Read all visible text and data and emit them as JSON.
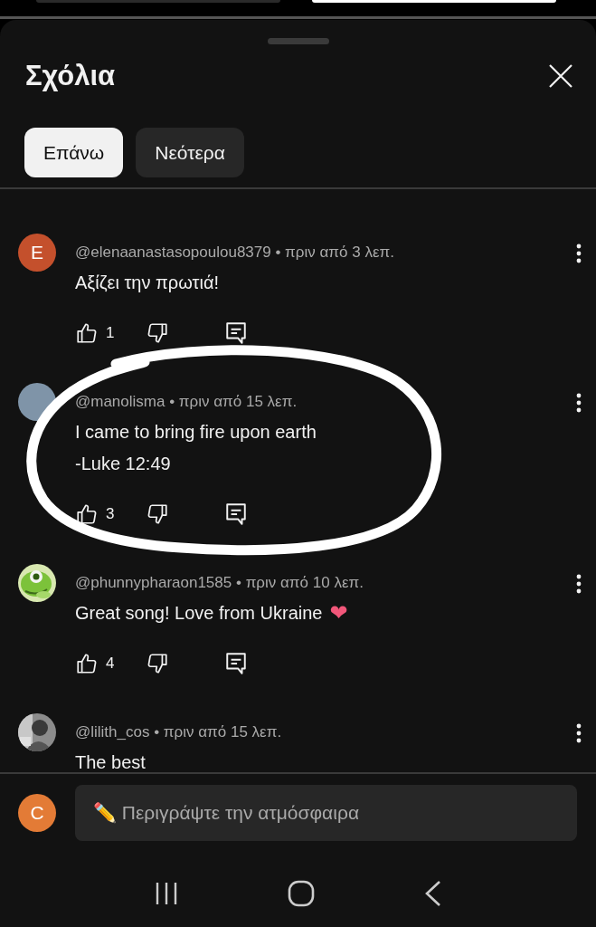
{
  "sheet": {
    "title": "Σχόλια"
  },
  "tabs": [
    {
      "label": "Επάνω",
      "selected": true
    },
    {
      "label": "Νεότερα",
      "selected": false
    }
  ],
  "comments": [
    {
      "author": "@elenaanastasopoulou8379",
      "dot": "•",
      "time": "πριν από 3 λεπ.",
      "lines": [
        "Αξίζει την πρωτιά!"
      ],
      "avatar": {
        "kind": "letter",
        "letter": "E",
        "color": "#c4502c"
      },
      "likes": "1"
    },
    {
      "author": "@manolisma",
      "dot": "•",
      "time": "πριν από 15 λεπ.",
      "lines": [
        "I came to bring fire upon earth",
        "-Luke 12:49"
      ],
      "avatar": {
        "kind": "letter",
        "color": "#7f94a8"
      },
      "likes": "3"
    },
    {
      "author": "@phunnypharaon1585",
      "dot": "•",
      "time": "πριν από 10 λεπ.",
      "lines": [
        "Great song! Love from Ukraine"
      ],
      "emoji": "❤",
      "avatar": {
        "kind": "picture"
      },
      "likes": "4"
    },
    {
      "author": "@lilith_cos",
      "dot": "•",
      "time": "πριν από 15 λεπ.",
      "lines": [
        "The best"
      ],
      "avatar": {
        "kind": "picture"
      }
    }
  ],
  "composer": {
    "avatar": {
      "letter": "C",
      "color": "#e37b36"
    },
    "placeholder": "✏️ Περιγράψτε την ατμόσφαιρα"
  }
}
